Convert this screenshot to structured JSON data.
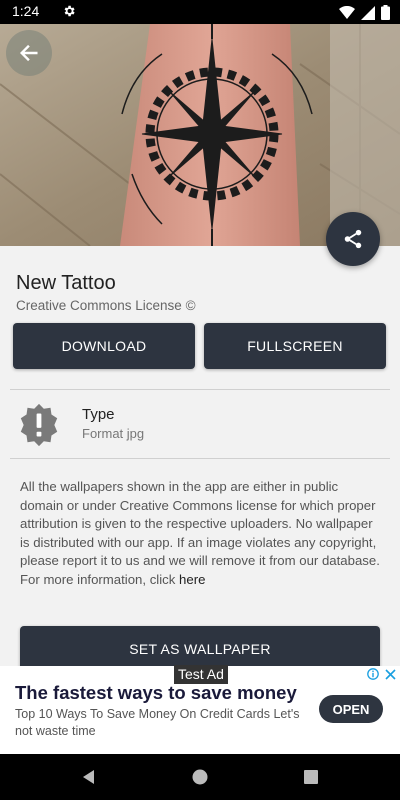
{
  "status_bar": {
    "time": "1:24"
  },
  "detail": {
    "title": "New Tattoo",
    "license": "Creative Commons License ©",
    "download_label": "DOWNLOAD",
    "fullscreen_label": "FULLSCREEN",
    "type_label": "Type",
    "type_value": "Format jpg",
    "disclaimer": "All the wallpapers shown in the app are either in public domain or under Creative Commons license for which proper attribution is given to the respective uploaders. No wallpaper is distributed with our app. If an image violates any copyright, please report it to us and we will remove it from our database. For more information, click ",
    "disclaimer_link": "here",
    "set_wallpaper_label": "SET AS WALLPAPER"
  },
  "ad": {
    "label": "Test Ad",
    "headline": "The fastest ways to save money",
    "body": "Top 10 Ways To Save Money On Credit Cards Let's not waste time",
    "open_label": "OPEN"
  },
  "icons": {
    "back": "arrow-left-icon",
    "share": "share-icon",
    "type": "alert-badge-icon",
    "settings": "gear-icon"
  },
  "colors": {
    "button_bg": "#2d3440",
    "page_bg": "#f2f2f2",
    "ad_title": "#1a1a3a"
  }
}
